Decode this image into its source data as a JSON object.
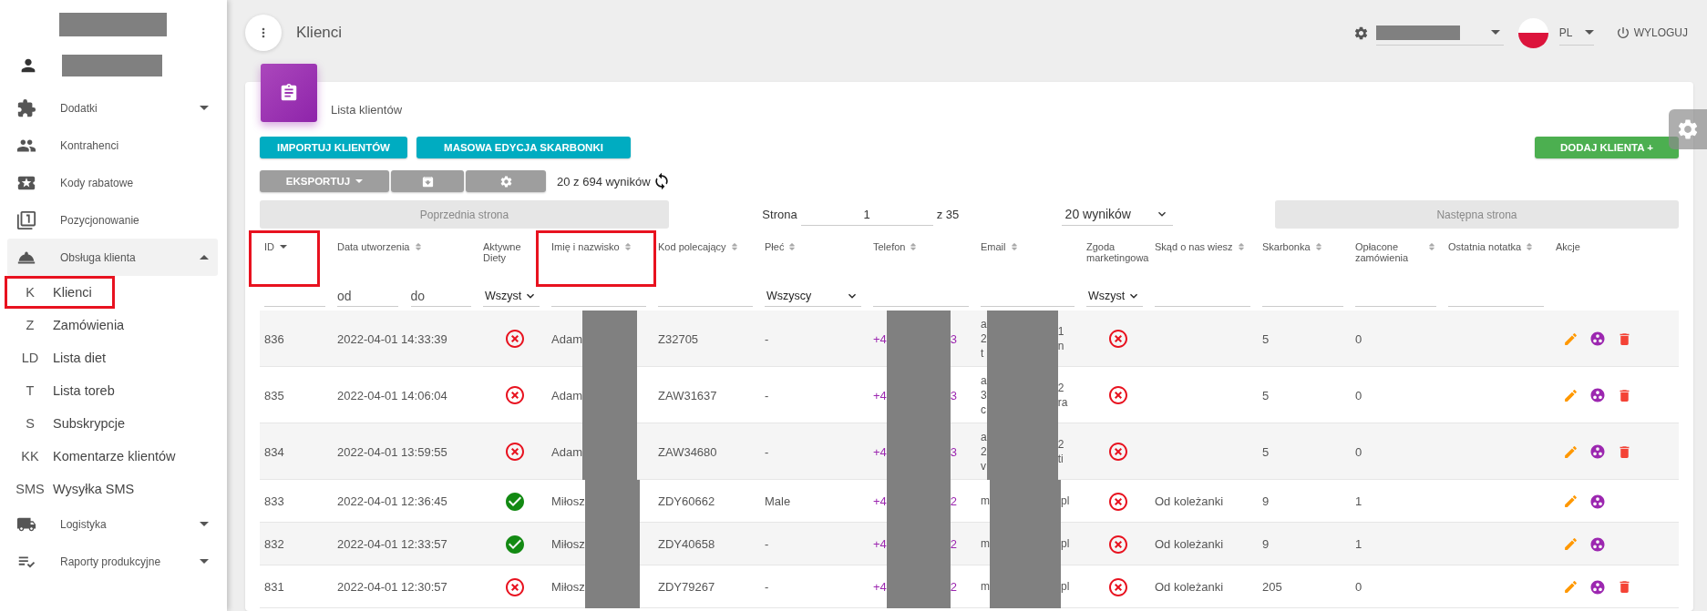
{
  "sidebar": {
    "items": [
      {
        "label": "Dodatki",
        "expandable": true,
        "expanded": false
      },
      {
        "label": "Kontrahenci",
        "expandable": false,
        "expanded": false
      },
      {
        "label": "Kody rabatowe",
        "expandable": false,
        "expanded": false
      },
      {
        "label": "Pozycjonowanie",
        "expandable": false,
        "expanded": false
      },
      {
        "label": "Obsługa klienta",
        "expandable": true,
        "expanded": true,
        "children": [
          {
            "abbr": "K",
            "label": "Klienci",
            "highlighted": true
          },
          {
            "abbr": "Z",
            "label": "Zamówienia",
            "highlighted": false
          },
          {
            "abbr": "LD",
            "label": "Lista diet",
            "highlighted": false
          },
          {
            "abbr": "T",
            "label": "Lista toreb",
            "highlighted": false
          },
          {
            "abbr": "S",
            "label": "Subskrypcje",
            "highlighted": false
          },
          {
            "abbr": "KK",
            "label": "Komentarze klientów",
            "highlighted": false
          },
          {
            "abbr": "SMS",
            "label": "Wysyłka SMS",
            "highlighted": false
          }
        ]
      },
      {
        "label": "Logistyka",
        "expandable": true,
        "expanded": false
      },
      {
        "label": "Raporty produkcyjne",
        "expandable": true,
        "expanded": false
      }
    ]
  },
  "header": {
    "title": "Klienci",
    "language": "PL",
    "logout": "WYLOGUJ"
  },
  "card": {
    "title": "Lista klientów",
    "import_button": "IMPORTUJ KLIENTÓW",
    "bulk_button": "MASOWA EDYCJA SKARBONKI",
    "add_button": "DODAJ KLIENTA +",
    "export_button": "EKSPORTUJ",
    "results": "20 z 694 wyników",
    "pagination": {
      "prev": "Poprzednia strona",
      "page_label": "Strona",
      "page": "1",
      "of": "z 35",
      "per_page": "20 wyników",
      "next": "Następna strona"
    }
  },
  "table": {
    "columns": [
      {
        "kind": "text",
        "label": "ID",
        "sortable": true,
        "sorted": true,
        "highlighted": true
      },
      {
        "kind": "range",
        "label": "Data utworzenia",
        "sortable": true,
        "sorted": false,
        "highlighted": false,
        "filter_values": [
          "od",
          "do"
        ]
      },
      {
        "kind": "select",
        "label": "Aktywne Diety",
        "sortable": false,
        "sorted": false,
        "highlighted": false,
        "filter_values": [
          "Wszyst"
        ]
      },
      {
        "kind": "text",
        "label": "Imię i nazwisko",
        "sortable": true,
        "sorted": false,
        "highlighted": true
      },
      {
        "kind": "text",
        "label": "Kod polecający",
        "sortable": true,
        "sorted": false,
        "highlighted": false
      },
      {
        "kind": "select",
        "label": "Płeć",
        "sortable": true,
        "sorted": false,
        "highlighted": false,
        "filter_values": [
          "Wszyscy"
        ]
      },
      {
        "kind": "text",
        "label": "Telefon",
        "sortable": true,
        "sorted": false,
        "highlighted": false
      },
      {
        "kind": "text",
        "label": "Email",
        "sortable": true,
        "sorted": false,
        "highlighted": false
      },
      {
        "kind": "select",
        "label": "Zgoda marketingowa",
        "sortable": false,
        "sorted": false,
        "highlighted": false,
        "filter_values": [
          "Wszyst"
        ]
      },
      {
        "kind": "text",
        "label": "Skąd o nas wiesz",
        "sortable": true,
        "sorted": false,
        "highlighted": false
      },
      {
        "kind": "text",
        "label": "Skarbonka",
        "sortable": true,
        "sorted": false,
        "highlighted": false
      },
      {
        "kind": "text",
        "label": "Opłacone zamówienia",
        "sortable": true,
        "sorted": false,
        "highlighted": false
      },
      {
        "kind": "text",
        "label": "Ostatnia notatka",
        "sortable": true,
        "sorted": false,
        "highlighted": false
      },
      {
        "kind": "none",
        "label": "Akcje",
        "sortable": false,
        "sorted": false,
        "highlighted": false
      }
    ],
    "rows": [
      {
        "id": "836",
        "created": "2022-04-01 14:33:39",
        "active_diets": false,
        "name": "Adam",
        "code": "Z32705",
        "gender": "-",
        "phone_start": "+4",
        "phone_end": "3",
        "email_start": [
          "a",
          "2",
          "t"
        ],
        "email_end": [
          "1",
          "n"
        ],
        "marketing": false,
        "piggy_bank": "5",
        "paid_orders": "0",
        "deletable": true
      },
      {
        "id": "835",
        "created": "2022-04-01 14:06:04",
        "active_diets": false,
        "name": "Adam",
        "code": "ZAW31637",
        "gender": "-",
        "phone_start": "+4",
        "phone_end": "3",
        "email_start": [
          "a",
          "3",
          "c"
        ],
        "email_end": [
          "2",
          "ra"
        ],
        "marketing": false,
        "piggy_bank": "5",
        "paid_orders": "0",
        "deletable": true
      },
      {
        "id": "834",
        "created": "2022-04-01 13:59:55",
        "active_diets": false,
        "name": "Adam",
        "code": "ZAW34680",
        "gender": "-",
        "phone_start": "+4",
        "phone_end": "3",
        "email_start": [
          "a",
          "2",
          "v"
        ],
        "email_end": [
          "2",
          "ti"
        ],
        "marketing": false,
        "piggy_bank": "5",
        "paid_orders": "0",
        "deletable": true
      },
      {
        "id": "833",
        "created": "2022-04-01 12:36:45",
        "active_diets": true,
        "name": "Miłosz",
        "code": "ZDY60662",
        "gender": "Male",
        "phone_start": "+4",
        "phone_end": "2",
        "email_start": [
          "m"
        ],
        "email_end": [
          "pl"
        ],
        "marketing": false,
        "source": "Od koleżanki",
        "piggy_bank": "9",
        "paid_orders": "1",
        "deletable": false
      },
      {
        "id": "832",
        "created": "2022-04-01 12:33:57",
        "active_diets": true,
        "name": "Miłosz",
        "code": "ZDY40658",
        "gender": "-",
        "phone_start": "+4",
        "phone_end": "2",
        "email_start": [
          "m"
        ],
        "email_end": [
          "pl"
        ],
        "marketing": false,
        "source": "Od koleżanki",
        "piggy_bank": "9",
        "paid_orders": "1",
        "deletable": false
      },
      {
        "id": "831",
        "created": "2022-04-01 12:30:57",
        "active_diets": false,
        "name": "Miłosz",
        "code": "ZDY79267",
        "gender": "-",
        "phone_start": "+4",
        "phone_end": "2",
        "email_start": [
          "m"
        ],
        "email_end": [
          "pl"
        ],
        "marketing": false,
        "source": "Od koleżanki",
        "piggy_bank": "205",
        "paid_orders": "0",
        "deletable": true
      }
    ]
  }
}
